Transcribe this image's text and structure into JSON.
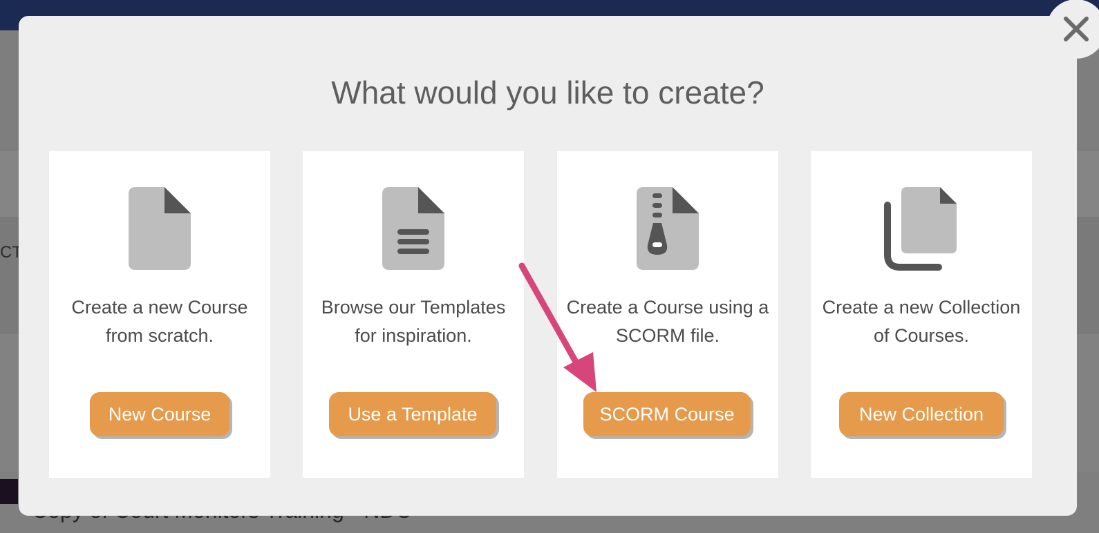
{
  "background": {
    "side_text": "CT",
    "row_title": "Copy of Court Monitors Training - NDC"
  },
  "modal": {
    "title": "What would you like to create?",
    "close_icon": "close-icon",
    "cards": [
      {
        "icon": "blank-file-icon",
        "description": "Create a new Course from scratch.",
        "button": "New Course"
      },
      {
        "icon": "file-lines-icon",
        "description": "Browse our Templates for inspiration.",
        "button": "Use a Template"
      },
      {
        "icon": "zip-file-icon",
        "description": "Create a Course using a SCORM file.",
        "button": "SCORM Course"
      },
      {
        "icon": "copy-files-icon",
        "description": "Create a new Collection of Courses.",
        "button": "New Collection"
      }
    ]
  },
  "colors": {
    "accent": "#e69a4b",
    "annotation_arrow": "#d6467a",
    "topbar": "#1b2a52"
  }
}
